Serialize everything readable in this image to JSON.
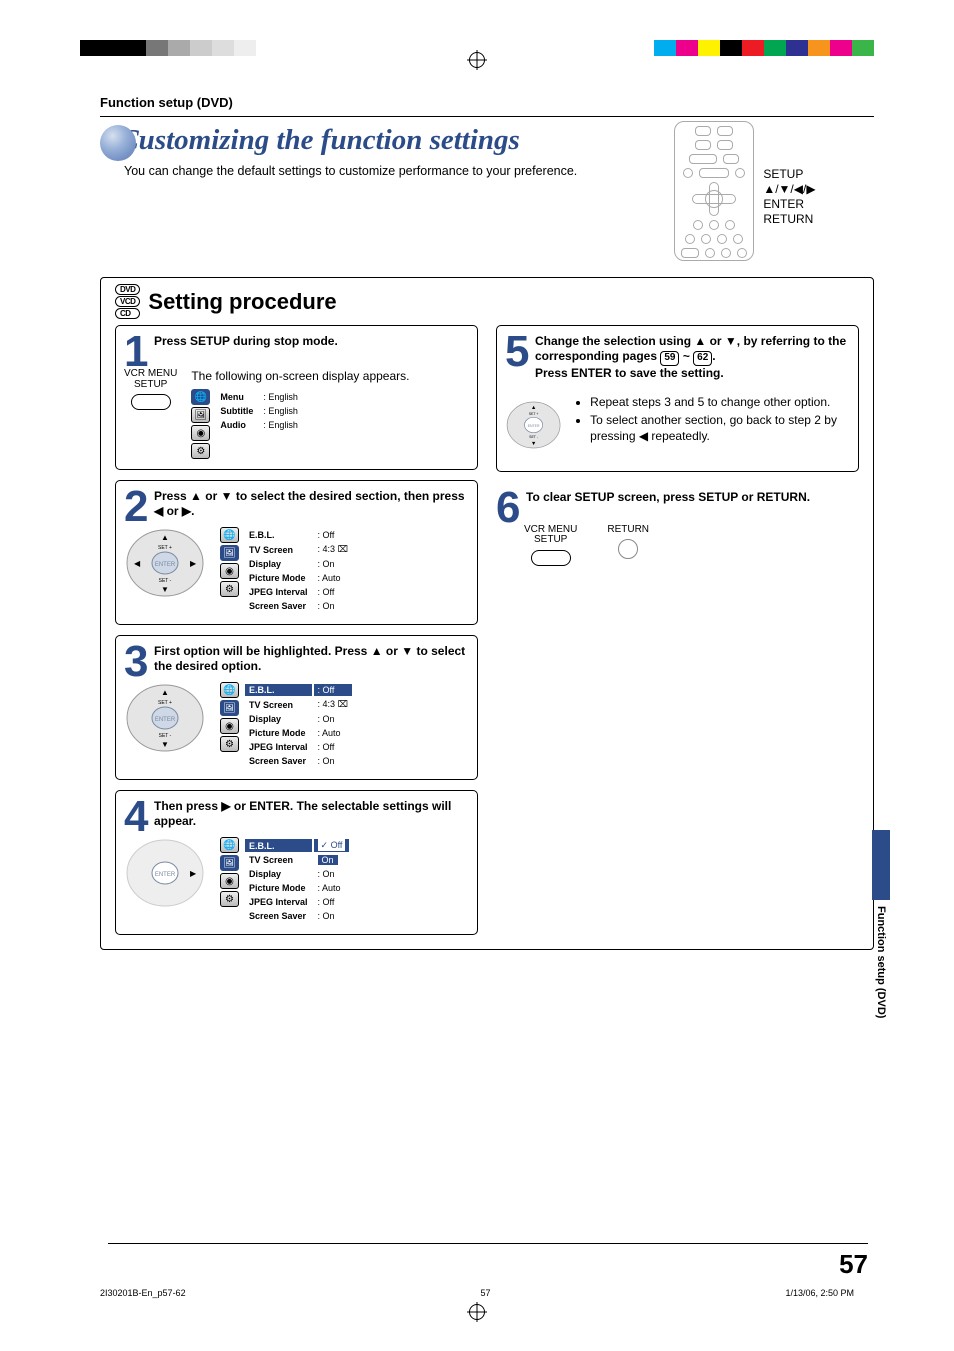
{
  "colors": {
    "accent": "#2b4c88",
    "swatches_left": [
      "#000",
      "#000",
      "#000",
      "#777",
      "#aaa",
      "#ccc",
      "#ddd",
      "#eee"
    ],
    "swatches_right": [
      "#00aeef",
      "#ec008c",
      "#fff200",
      "#000",
      "#ed1c24",
      "#00a651",
      "#2e3192",
      "#f7941e",
      "#ec008c",
      "#39b54a"
    ]
  },
  "header": {
    "section": "Function setup (DVD)",
    "title": "Customizing the function settings",
    "subtitle": "You can change the default settings to customize performance to your preference."
  },
  "remote_labels": {
    "setup": "SETUP",
    "arrows": "▲/▼/◀/▶",
    "enter": "ENTER",
    "return": "RETURN"
  },
  "disc_badges": [
    "DVD",
    "VCD",
    "CD"
  ],
  "procedure_title": "Setting procedure",
  "steps": [
    {
      "n": "1",
      "title": "Press SETUP during stop mode.",
      "button_label": "VCR MENU\nSETUP",
      "body_text": "The following on-screen display appears.",
      "osd_rows": [
        {
          "k": "Menu",
          "v": ": English"
        },
        {
          "k": "Subtitle",
          "v": ": English"
        },
        {
          "k": "Audio",
          "v": ": English"
        }
      ]
    },
    {
      "n": "2",
      "title_parts": [
        "Press ",
        "▲",
        " or ",
        "▼",
        " to select the desired section, then press ",
        "◀",
        " or ",
        "▶",
        "."
      ],
      "osd_rows": [
        {
          "k": "E.B.L.",
          "v": ": Off"
        },
        {
          "k": "TV Screen",
          "v": ": 4:3",
          "tv": true
        },
        {
          "k": "Display",
          "v": ": On"
        },
        {
          "k": "Picture Mode",
          "v": ": Auto"
        },
        {
          "k": "JPEG Interval",
          "v": ": Off"
        },
        {
          "k": "Screen Saver",
          "v": ": On"
        }
      ]
    },
    {
      "n": "3",
      "title_parts": [
        "First option will be highlighted. Press ",
        "▲",
        " or ",
        "▼",
        " to select the desired option."
      ],
      "highlight_row": 0,
      "osd_rows": [
        {
          "k": "E.B.L.",
          "v": ": Off"
        },
        {
          "k": "TV Screen",
          "v": ": 4:3",
          "tv": true
        },
        {
          "k": "Display",
          "v": ": On"
        },
        {
          "k": "Picture Mode",
          "v": ": Auto"
        },
        {
          "k": "JPEG Interval",
          "v": ": Off"
        },
        {
          "k": "Screen Saver",
          "v": ": On"
        }
      ]
    },
    {
      "n": "4",
      "title_parts": [
        "Then press ",
        "▶",
        " or ENTER. The selectable settings will appear."
      ],
      "popup": [
        "Off",
        "On"
      ],
      "popup_sel": 0,
      "osd_rows": [
        {
          "k": "E.B.L.",
          "v": ""
        },
        {
          "k": "TV Screen",
          "v": ""
        },
        {
          "k": "Display",
          "v": ": On"
        },
        {
          "k": "Picture Mode",
          "v": ": Auto"
        },
        {
          "k": "JPEG Interval",
          "v": ": Off"
        },
        {
          "k": "Screen Saver",
          "v": ": On"
        }
      ]
    },
    {
      "n": "5",
      "title_parts_a": "Change the selection using ▲ or ▼, by referring to the corresponding pages ",
      "title_parts_b": ".",
      "page_from": "59",
      "page_to": "62",
      "line2": "Press ENTER to save the setting.",
      "bullets": [
        "Repeat steps 3 and 5 to change other option.",
        "To select another section, go back to step 2 by pressing ◀ repeatedly."
      ]
    },
    {
      "n": "6",
      "title": "To clear SETUP screen, press SETUP or RETURN.",
      "button_label": "VCR MENU\nSETUP",
      "button2_label": "RETURN"
    }
  ],
  "side_tab": "Function setup (DVD)",
  "page_number": "57",
  "footer": {
    "file": "2I30201B-En_p57-62",
    "page": "57",
    "timestamp": "1/13/06, 2:50 PM"
  }
}
